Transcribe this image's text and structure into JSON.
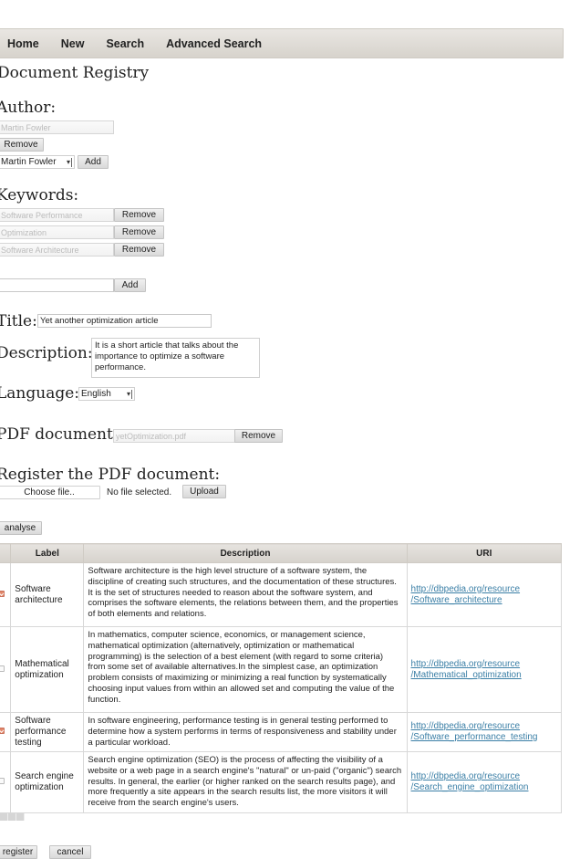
{
  "nav": {
    "items": [
      {
        "label": "Home"
      },
      {
        "label": "New"
      },
      {
        "label": "Search"
      },
      {
        "label": "Advanced Search"
      }
    ]
  },
  "page": {
    "title": "Document Registry"
  },
  "author": {
    "heading": "Author:",
    "current_value": "Martin Fowler",
    "remove_label": "Remove",
    "select_value": "Martin Fowler",
    "add_label": "Add"
  },
  "keywords": {
    "heading": "Keywords:",
    "items": [
      {
        "value": "Software Performance",
        "remove_label": "Remove"
      },
      {
        "value": "Optimization",
        "remove_label": "Remove"
      },
      {
        "value": "Software Architecture",
        "remove_label": "Remove"
      }
    ],
    "new_value": "",
    "add_label": "Add"
  },
  "title_field": {
    "label": "Title:",
    "value": "Yet another optimization article"
  },
  "description_field": {
    "label": "Description:",
    "value": "It is a short article that talks about the importance to optimize a software performance."
  },
  "language_field": {
    "label": "Language:",
    "value": "English"
  },
  "pdf": {
    "label": "PDF document:",
    "value": "yetOptimization.pdf",
    "remove_label": "Remove"
  },
  "register_pdf": {
    "heading": "Register the PDF document:",
    "choose_label": "Choose file..",
    "no_file_text": "No file selected.",
    "upload_label": "Upload"
  },
  "analyse_label": "analyse",
  "results": {
    "columns": [
      "",
      "Label",
      "Description",
      "URI"
    ],
    "rows": [
      {
        "checked": true,
        "label": "Software architecture",
        "description": "Software architecture is the high level structure of a software system, the discipline of creating such structures, and the documentation of these structures. It is the set of structures needed to reason about the software system, and comprises the software elements, the relations between them, and the properties of both elements and relations.",
        "uri_line1": "http://dbpedia.org/resource",
        "uri_line2": "/Software_architecture"
      },
      {
        "checked": false,
        "label": "Mathematical optimization",
        "description": "In mathematics, computer science, economics, or management science, mathematical optimization (alternatively, optimization or mathematical programming) is the selection of a best element (with regard to some criteria) from some set of available alternatives.In the simplest case, an optimization problem consists of maximizing or minimizing a real function by systematically choosing input values from within an allowed set and computing the value of the function.",
        "uri_line1": "http://dbpedia.org/resource",
        "uri_line2": "/Mathematical_optimization"
      },
      {
        "checked": true,
        "label": "Software performance testing",
        "description": "In software engineering, performance testing is in general testing performed to determine how a system performs in terms of responsiveness and stability under a particular workload.",
        "uri_line1": "http://dbpedia.org/resource",
        "uri_line2": "/Software_performance_testing"
      },
      {
        "checked": false,
        "label": "Search engine optimization",
        "description": "Search engine optimization (SEO) is the process of affecting the visibility of a website or a web page in a search engine's \"natural\" or un-paid (\"organic\") search results. In general, the earlier (or higher ranked on the search results page), and more frequently a site appears in the search results list, the more visitors it will receive from the search engine's users.",
        "uri_line1": "http://dbpedia.org/resource",
        "uri_line2": "/Search_engine_optimization"
      }
    ]
  },
  "footer": {
    "register_label": "register",
    "cancel_label": "cancel"
  },
  "colors": {
    "link": "#3b7fa6",
    "checkbox_checked": "#e2876a",
    "nav_bg": "#dedad4"
  }
}
